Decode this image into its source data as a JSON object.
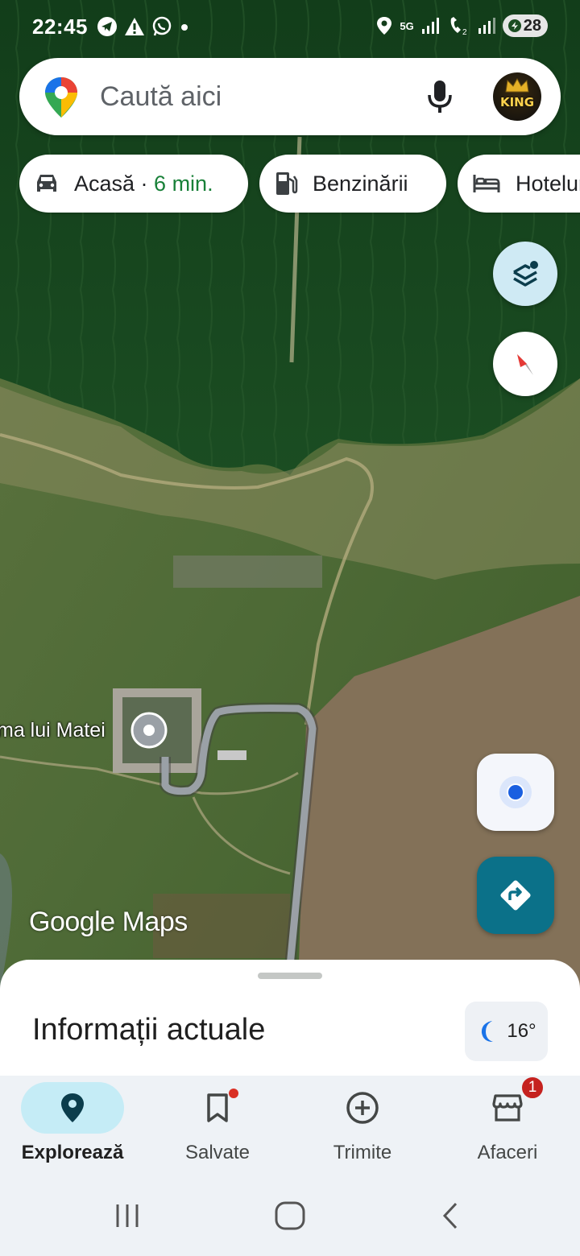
{
  "status_bar": {
    "time": "22:45",
    "battery": "28",
    "network": "5G"
  },
  "search": {
    "placeholder": "Caută aici",
    "avatar_text": "KING"
  },
  "chips": [
    {
      "label": "Acasă · ",
      "eta": "6 min.",
      "icon": "car-icon"
    },
    {
      "label": "Benzinării",
      "icon": "gas-station-icon"
    },
    {
      "label": "Hoteluri",
      "icon": "bed-icon"
    }
  ],
  "map": {
    "place_label": "ma lui Matei",
    "attribution": "Google Maps"
  },
  "sheet": {
    "title": "Informații actuale",
    "temperature": "16°"
  },
  "bottom_nav": [
    {
      "label": "Explorează",
      "icon": "location-pin-icon",
      "active": true
    },
    {
      "label": "Salvate",
      "icon": "bookmark-icon",
      "dot": true
    },
    {
      "label": "Trimite",
      "icon": "add-circle-icon"
    },
    {
      "label": "Afaceri",
      "icon": "storefront-icon",
      "badge": "1"
    }
  ],
  "colors": {
    "eta": "#188038",
    "layers_bg": "#cfeaf4",
    "directions_bg": "#0b7189",
    "active_nav": "#c5ecf6",
    "badge": "#c5221f"
  }
}
